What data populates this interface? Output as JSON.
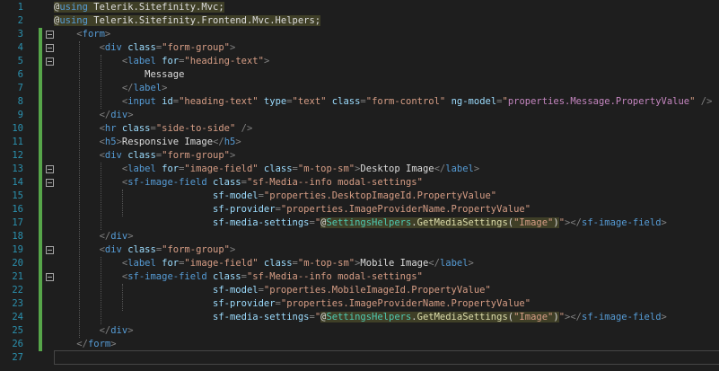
{
  "editor": {
    "line_numbers": [
      "1",
      "2",
      "3",
      "4",
      "5",
      "6",
      "7",
      "8",
      "9",
      "10",
      "11",
      "12",
      "13",
      "14",
      "15",
      "16",
      "17",
      "18",
      "19",
      "20",
      "21",
      "22",
      "23",
      "24",
      "25",
      "26",
      "27"
    ],
    "lines": [
      [
        {
          "t": "@",
          "c": "razor"
        },
        {
          "t": "using",
          "c": "using razorb"
        },
        {
          "t": " Telerik.Sitefinity.Mvc;",
          "c": "razorb"
        }
      ],
      [
        {
          "t": "@",
          "c": "razor"
        },
        {
          "t": "using",
          "c": "using razorb"
        },
        {
          "t": " Telerik.Sitefinity.Frontend.Mvc.Helpers;",
          "c": "razorb"
        }
      ],
      [
        {
          "t": "    ",
          "c": ""
        },
        {
          "t": "<",
          "c": "delim"
        },
        {
          "t": "form",
          "c": "tag"
        },
        {
          "t": ">",
          "c": "delim"
        }
      ],
      [
        {
          "t": "        ",
          "c": ""
        },
        {
          "t": "<",
          "c": "delim"
        },
        {
          "t": "div",
          "c": "tag"
        },
        {
          "t": " class",
          "c": "attr"
        },
        {
          "t": "=",
          "c": "delim"
        },
        {
          "t": "\"form-group\"",
          "c": "str"
        },
        {
          "t": ">",
          "c": "delim"
        }
      ],
      [
        {
          "t": "            ",
          "c": ""
        },
        {
          "t": "<",
          "c": "delim"
        },
        {
          "t": "label",
          "c": "tag"
        },
        {
          "t": " for",
          "c": "attr"
        },
        {
          "t": "=",
          "c": "delim"
        },
        {
          "t": "\"heading-text\"",
          "c": "str"
        },
        {
          "t": ">",
          "c": "delim"
        }
      ],
      [
        {
          "t": "                Message",
          "c": ""
        }
      ],
      [
        {
          "t": "            ",
          "c": ""
        },
        {
          "t": "</",
          "c": "delim"
        },
        {
          "t": "label",
          "c": "tag"
        },
        {
          "t": ">",
          "c": "delim"
        }
      ],
      [
        {
          "t": "            ",
          "c": ""
        },
        {
          "t": "<",
          "c": "delim"
        },
        {
          "t": "input",
          "c": "tag"
        },
        {
          "t": " id",
          "c": "attr"
        },
        {
          "t": "=",
          "c": "delim"
        },
        {
          "t": "\"heading-text\"",
          "c": "str"
        },
        {
          "t": " type",
          "c": "attr"
        },
        {
          "t": "=",
          "c": "delim"
        },
        {
          "t": "\"text\"",
          "c": "str"
        },
        {
          "t": " class",
          "c": "attr"
        },
        {
          "t": "=",
          "c": "delim"
        },
        {
          "t": "\"form-control\"",
          "c": "str"
        },
        {
          "t": " ng-model",
          "c": "attr"
        },
        {
          "t": "=",
          "c": "delim"
        },
        {
          "t": "\"",
          "c": "str"
        },
        {
          "t": "properties.Message.PropertyValue",
          "c": "ng"
        },
        {
          "t": "\"",
          "c": "str"
        },
        {
          "t": " />",
          "c": "delim"
        }
      ],
      [
        {
          "t": "        ",
          "c": ""
        },
        {
          "t": "</",
          "c": "delim"
        },
        {
          "t": "div",
          "c": "tag"
        },
        {
          "t": ">",
          "c": "delim"
        }
      ],
      [
        {
          "t": "        ",
          "c": ""
        },
        {
          "t": "<",
          "c": "delim"
        },
        {
          "t": "hr",
          "c": "tag"
        },
        {
          "t": " class",
          "c": "attr"
        },
        {
          "t": "=",
          "c": "delim"
        },
        {
          "t": "\"side-to-side\"",
          "c": "str"
        },
        {
          "t": " />",
          "c": "delim"
        }
      ],
      [
        {
          "t": "        ",
          "c": ""
        },
        {
          "t": "<",
          "c": "delim"
        },
        {
          "t": "h5",
          "c": "tag"
        },
        {
          "t": ">",
          "c": "delim"
        },
        {
          "t": "Responsive Image",
          "c": ""
        },
        {
          "t": "</",
          "c": "delim"
        },
        {
          "t": "h5",
          "c": "tag"
        },
        {
          "t": ">",
          "c": "delim"
        }
      ],
      [
        {
          "t": "        ",
          "c": ""
        },
        {
          "t": "<",
          "c": "delim"
        },
        {
          "t": "div",
          "c": "tag"
        },
        {
          "t": " class",
          "c": "attr"
        },
        {
          "t": "=",
          "c": "delim"
        },
        {
          "t": "\"form-group\"",
          "c": "str"
        },
        {
          "t": ">",
          "c": "delim"
        }
      ],
      [
        {
          "t": "            ",
          "c": ""
        },
        {
          "t": "<",
          "c": "delim"
        },
        {
          "t": "label",
          "c": "tag"
        },
        {
          "t": " for",
          "c": "attr"
        },
        {
          "t": "=",
          "c": "delim"
        },
        {
          "t": "\"image-field\"",
          "c": "str"
        },
        {
          "t": " class",
          "c": "attr"
        },
        {
          "t": "=",
          "c": "delim"
        },
        {
          "t": "\"m-top-sm\"",
          "c": "str"
        },
        {
          "t": ">",
          "c": "delim"
        },
        {
          "t": "Desktop Image",
          "c": ""
        },
        {
          "t": "</",
          "c": "delim"
        },
        {
          "t": "label",
          "c": "tag"
        },
        {
          "t": ">",
          "c": "delim"
        }
      ],
      [
        {
          "t": "            ",
          "c": ""
        },
        {
          "t": "<",
          "c": "delim"
        },
        {
          "t": "sf-image-field",
          "c": "tag"
        },
        {
          "t": " class",
          "c": "attr"
        },
        {
          "t": "=",
          "c": "delim"
        },
        {
          "t": "\"sf-Media--info modal-settings\"",
          "c": "str"
        }
      ],
      [
        {
          "t": "                            ",
          "c": ""
        },
        {
          "t": "sf-model",
          "c": "attr"
        },
        {
          "t": "=",
          "c": "delim"
        },
        {
          "t": "\"properties.DesktopImageId.PropertyValue\"",
          "c": "str"
        }
      ],
      [
        {
          "t": "                            ",
          "c": ""
        },
        {
          "t": "sf-provider",
          "c": "attr"
        },
        {
          "t": "=",
          "c": "delim"
        },
        {
          "t": "\"properties.ImageProviderName.PropertyValue\"",
          "c": "str"
        }
      ],
      [
        {
          "t": "                            ",
          "c": ""
        },
        {
          "t": "sf-media-settings",
          "c": "attr"
        },
        {
          "t": "=",
          "c": "delim"
        },
        {
          "t": "\"",
          "c": "str"
        },
        {
          "t": "@",
          "c": "razor"
        },
        {
          "t": "SettingsHelpers",
          "c": "cls razorb"
        },
        {
          "t": ".",
          "c": "razorb"
        },
        {
          "t": "GetMediaSettings",
          "c": "meth razorb"
        },
        {
          "t": "(",
          "c": "razorb"
        },
        {
          "t": "\"Image\"",
          "c": "str razorb"
        },
        {
          "t": ")",
          "c": "razorb"
        },
        {
          "t": "\"",
          "c": "str"
        },
        {
          "t": ">",
          "c": "delim"
        },
        {
          "t": "</",
          "c": "delim"
        },
        {
          "t": "sf-image-field",
          "c": "tag"
        },
        {
          "t": ">",
          "c": "delim"
        }
      ],
      [
        {
          "t": "        ",
          "c": ""
        },
        {
          "t": "</",
          "c": "delim"
        },
        {
          "t": "div",
          "c": "tag"
        },
        {
          "t": ">",
          "c": "delim"
        }
      ],
      [
        {
          "t": "        ",
          "c": ""
        },
        {
          "t": "<",
          "c": "delim"
        },
        {
          "t": "div",
          "c": "tag"
        },
        {
          "t": " class",
          "c": "attr"
        },
        {
          "t": "=",
          "c": "delim"
        },
        {
          "t": "\"form-group\"",
          "c": "str"
        },
        {
          "t": ">",
          "c": "delim"
        }
      ],
      [
        {
          "t": "            ",
          "c": ""
        },
        {
          "t": "<",
          "c": "delim"
        },
        {
          "t": "label",
          "c": "tag"
        },
        {
          "t": " for",
          "c": "attr"
        },
        {
          "t": "=",
          "c": "delim"
        },
        {
          "t": "\"image-field\"",
          "c": "str"
        },
        {
          "t": " class",
          "c": "attr"
        },
        {
          "t": "=",
          "c": "delim"
        },
        {
          "t": "\"m-top-sm\"",
          "c": "str"
        },
        {
          "t": ">",
          "c": "delim"
        },
        {
          "t": "Mobile Image",
          "c": ""
        },
        {
          "t": "</",
          "c": "delim"
        },
        {
          "t": "label",
          "c": "tag"
        },
        {
          "t": ">",
          "c": "delim"
        }
      ],
      [
        {
          "t": "            ",
          "c": ""
        },
        {
          "t": "<",
          "c": "delim"
        },
        {
          "t": "sf-image-field",
          "c": "tag"
        },
        {
          "t": " class",
          "c": "attr"
        },
        {
          "t": "=",
          "c": "delim"
        },
        {
          "t": "\"sf-Media--info modal-settings\"",
          "c": "str"
        }
      ],
      [
        {
          "t": "                            ",
          "c": ""
        },
        {
          "t": "sf-model",
          "c": "attr"
        },
        {
          "t": "=",
          "c": "delim"
        },
        {
          "t": "\"properties.MobileImageId.PropertyValue\"",
          "c": "str"
        }
      ],
      [
        {
          "t": "                            ",
          "c": ""
        },
        {
          "t": "sf-provider",
          "c": "attr"
        },
        {
          "t": "=",
          "c": "delim"
        },
        {
          "t": "\"properties.ImageProviderName.PropertyValue\"",
          "c": "str"
        }
      ],
      [
        {
          "t": "                            ",
          "c": ""
        },
        {
          "t": "sf-media-settings",
          "c": "attr"
        },
        {
          "t": "=",
          "c": "delim"
        },
        {
          "t": "\"",
          "c": "str"
        },
        {
          "t": "@",
          "c": "razor"
        },
        {
          "t": "SettingsHelpers",
          "c": "cls razorb"
        },
        {
          "t": ".",
          "c": "razorb"
        },
        {
          "t": "GetMediaSettings",
          "c": "meth razorb"
        },
        {
          "t": "(",
          "c": "razorb"
        },
        {
          "t": "\"Image\"",
          "c": "str razorb"
        },
        {
          "t": ")",
          "c": "razorb"
        },
        {
          "t": "\"",
          "c": "str"
        },
        {
          "t": ">",
          "c": "delim"
        },
        {
          "t": "</",
          "c": "delim"
        },
        {
          "t": "sf-image-field",
          "c": "tag"
        },
        {
          "t": ">",
          "c": "delim"
        }
      ],
      [
        {
          "t": "        ",
          "c": ""
        },
        {
          "t": "</",
          "c": "delim"
        },
        {
          "t": "div",
          "c": "tag"
        },
        {
          "t": ">",
          "c": "delim"
        }
      ],
      [
        {
          "t": "    ",
          "c": ""
        },
        {
          "t": "</",
          "c": "delim"
        },
        {
          "t": "form",
          "c": "tag"
        },
        {
          "t": ">",
          "c": "delim"
        }
      ],
      []
    ],
    "change_markers": [
      "none",
      "none",
      "saved",
      "saved",
      "saved",
      "saved",
      "saved",
      "saved",
      "saved",
      "saved",
      "saved",
      "saved",
      "saved",
      "saved",
      "saved",
      "saved",
      "saved",
      "saved",
      "saved",
      "saved",
      "saved",
      "saved",
      "saved",
      "saved",
      "saved",
      "saved",
      "none"
    ],
    "fold_lines": [
      3,
      4,
      5,
      13,
      14,
      19,
      21
    ]
  }
}
